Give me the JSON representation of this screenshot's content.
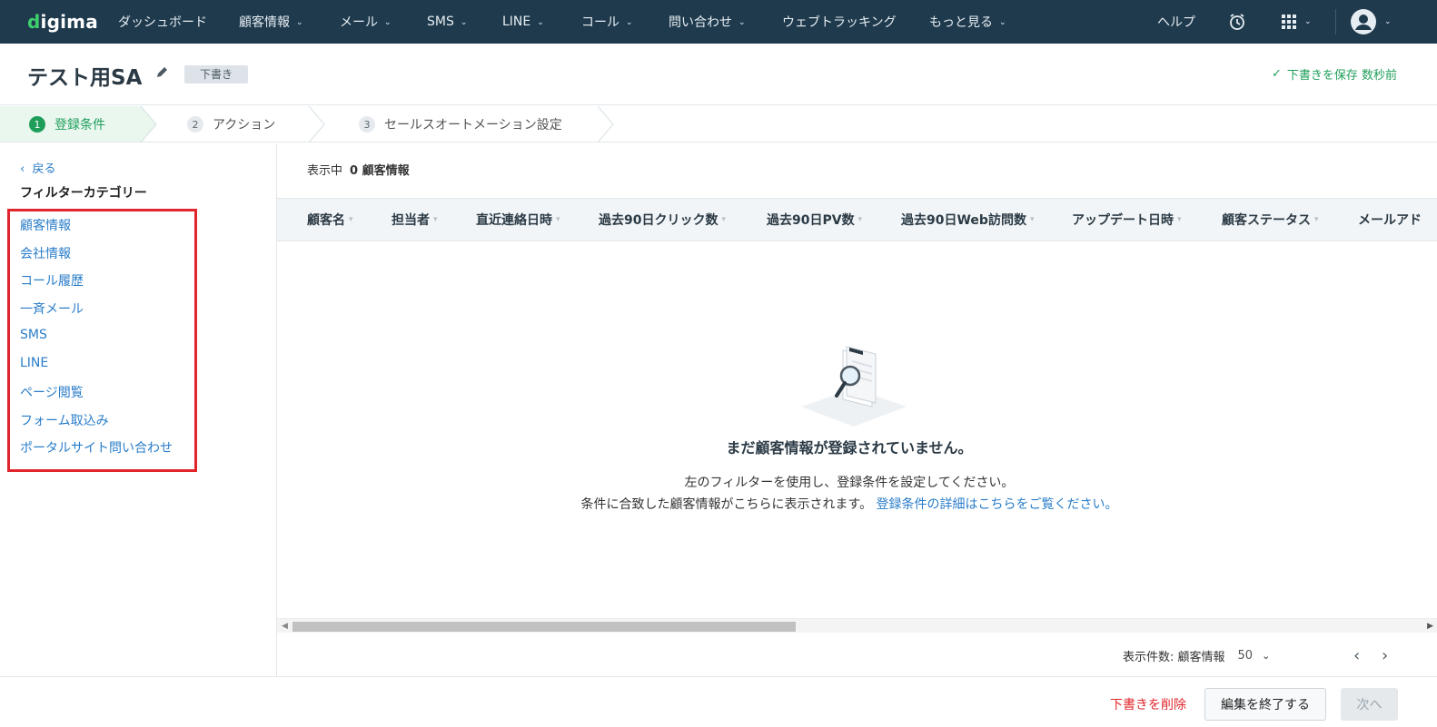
{
  "nav": {
    "logo": "digima",
    "items": [
      {
        "label": "ダッシュボード",
        "dropdown": false
      },
      {
        "label": "顧客情報",
        "dropdown": true
      },
      {
        "label": "メール",
        "dropdown": true
      },
      {
        "label": "SMS",
        "dropdown": true
      },
      {
        "label": "LINE",
        "dropdown": true
      },
      {
        "label": "コール",
        "dropdown": true
      },
      {
        "label": "問い合わせ",
        "dropdown": true
      },
      {
        "label": "ウェブトラッキング",
        "dropdown": false
      },
      {
        "label": "もっと見る",
        "dropdown": true
      }
    ],
    "help": "ヘルプ",
    "icons": [
      "alarm-clock-icon",
      "apps-grid-icon",
      "user-avatar-icon"
    ]
  },
  "header": {
    "title": "テスト用SA",
    "badge": "下書き",
    "saved_status": "下書きを保存 数秒前"
  },
  "steps": [
    {
      "num": "1",
      "label": "登録条件",
      "active": true
    },
    {
      "num": "2",
      "label": "アクション",
      "active": false
    },
    {
      "num": "3",
      "label": "セールスオートメーション設定",
      "active": false
    }
  ],
  "sidebar": {
    "back": "戻る",
    "title": "フィルターカテゴリー",
    "categories": [
      "顧客情報",
      "会社情報",
      "コール履歴",
      "一斉メール",
      "SMS",
      "LINE",
      "ページ閲覧",
      "フォーム取込み",
      "ポータルサイト問い合わせ"
    ]
  },
  "main": {
    "showing_label": "表示中",
    "showing_value": "0 顧客情報",
    "columns": [
      "顧客名",
      "担当者",
      "直近連絡日時",
      "過去90日クリック数",
      "過去90日PV数",
      "過去90日Web訪問数",
      "アップデート日時",
      "顧客ステータス",
      "メールアド"
    ],
    "empty_title": "まだ顧客情報が登録されていません。",
    "empty_line1": "左のフィルターを使用し、登録条件を設定してください。",
    "empty_line2": "条件に合致した顧客情報がこちらに表示されます。",
    "empty_link": "登録条件の詳細はこちらをご覧ください。",
    "page_size_label": "表示件数: 顧客情報",
    "page_size_value": "50"
  },
  "footer": {
    "delete_draft": "下書きを削除",
    "end_edit": "編集を終了する",
    "next": "次へ"
  },
  "colors": {
    "nav_bg": "#1f3a4d",
    "accent_green": "#1f9e5a",
    "link_blue": "#2a7dc9",
    "danger_red": "#e0262c"
  }
}
